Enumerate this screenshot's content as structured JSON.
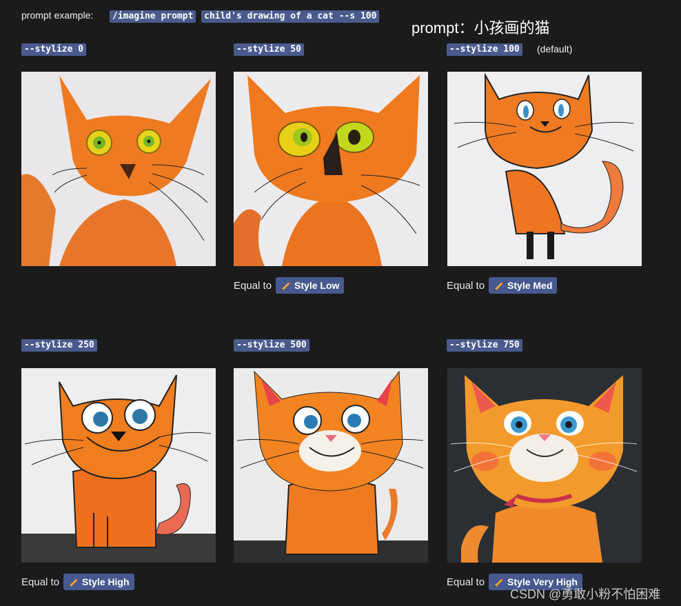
{
  "header": {
    "prompt_example_label": "prompt example:",
    "command_chip": "/imagine prompt",
    "prompt_chip": "child's drawing of a cat --s 100",
    "chinese_title": "prompt：小孩画的猫"
  },
  "panels": [
    {
      "label": "--stylize 0",
      "suffix": "",
      "equal_to": "",
      "style_label": ""
    },
    {
      "label": "--stylize 50",
      "suffix": "",
      "equal_to": "Equal to",
      "style_label": "Style Low"
    },
    {
      "label": "--stylize 100",
      "suffix": "(default)",
      "equal_to": "Equal to",
      "style_label": "Style Med"
    },
    {
      "label": "--stylize 250",
      "suffix": "",
      "equal_to": "Equal to",
      "style_label": "Style High"
    },
    {
      "label": "--stylize 500",
      "suffix": "",
      "equal_to": "",
      "style_label": ""
    },
    {
      "label": "--stylize 750",
      "suffix": "",
      "equal_to": "Equal to",
      "style_label": "Style Very High"
    }
  ],
  "icons": {
    "style_pill": "pencil-icon"
  },
  "watermark": "CSDN @勇敢小粉不怕困难",
  "colors": {
    "background": "#1b1b1c",
    "chip": "#4a5a8c",
    "cat_orange": "#f07a1e"
  }
}
